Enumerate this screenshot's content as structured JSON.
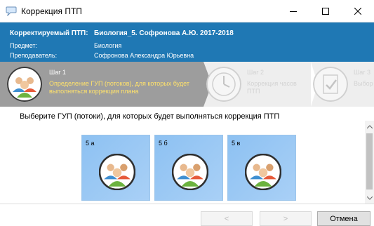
{
  "window": {
    "title": "Коррекция ПТП",
    "app_icon": "speech-bubble-icon",
    "controls": {
      "minimize": "minimize-icon",
      "maximize": "maximize-icon",
      "close": "close-icon"
    }
  },
  "header": {
    "row1": {
      "label": "Корректируемый ПТП:",
      "value": "Биология_5. Софронова А.Ю. 2017-2018"
    },
    "row2": {
      "label": "Предмет:",
      "value": "Биология"
    },
    "row3": {
      "label": "Преподаватель:",
      "value": "Софронова Александра Юрьевна"
    }
  },
  "steps": [
    {
      "number": "Шаг 1",
      "text": "Определение ГУП (потоков), для которых будет выполняться коррекция плана",
      "icon": "group-people-icon",
      "active": true
    },
    {
      "number": "Шаг 2",
      "text": "Коррекция часов ПТП",
      "icon": "clock-icon",
      "active": false
    },
    {
      "number": "Шаг 3",
      "text": "Выбор сокра",
      "icon": "checklist-icon",
      "active": false
    }
  ],
  "main": {
    "instruction": "Выберите ГУП (потоки), для которых будет выполняться коррекция ПТП",
    "groups": [
      {
        "label": "5 а",
        "icon": "group-people-icon"
      },
      {
        "label": "5 б",
        "icon": "group-people-icon"
      },
      {
        "label": "5 в",
        "icon": "group-people-icon"
      }
    ]
  },
  "footer": {
    "back_label": "<",
    "next_label": ">",
    "cancel_label": "Отмена"
  },
  "colors": {
    "header_bg": "#1f78b4",
    "active_step_bg": "#9d9d9d",
    "active_step_text": "#ffe26b",
    "tile_bg": "#8dc1f2"
  }
}
